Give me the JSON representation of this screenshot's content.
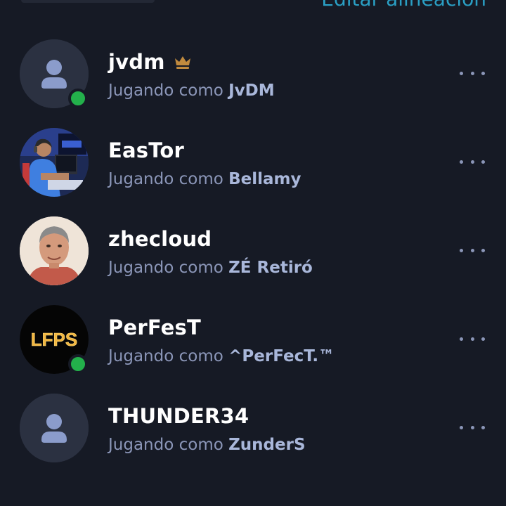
{
  "header": {
    "action_label": "Editar alineación"
  },
  "status_prefix": "Jugando como",
  "colors": {
    "background": "#161a25",
    "online": "#23b04b",
    "crown": "#c08a3e",
    "accent_link": "#2a9fc4"
  },
  "members": [
    {
      "name": "jvdm",
      "nickname": "JvDM",
      "online": true,
      "is_leader": true,
      "avatar": "default-user-icon"
    },
    {
      "name": "EasTor",
      "nickname": "Bellamy",
      "online": false,
      "is_leader": false,
      "avatar": "gamer-photo"
    },
    {
      "name": "zhecloud",
      "nickname": "ZÉ Retiró",
      "online": false,
      "is_leader": false,
      "avatar": "man-portrait-photo"
    },
    {
      "name": "PerFesT",
      "nickname": "^PerFecT.™",
      "online": true,
      "is_leader": false,
      "avatar": "lfps-logo",
      "avatar_logo_text": "LFPS"
    },
    {
      "name": "THUNDER34",
      "nickname": "ZunderS",
      "online": false,
      "is_leader": false,
      "avatar": "default-user-icon"
    }
  ]
}
